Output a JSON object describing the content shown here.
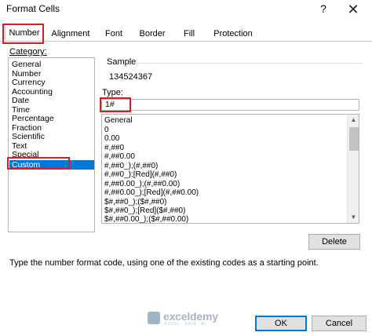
{
  "window": {
    "title": "Format Cells",
    "help_glyph": "?",
    "close_glyph": "✕"
  },
  "tabs": [
    {
      "label": "Number",
      "active": true
    },
    {
      "label": "Alignment"
    },
    {
      "label": "Font"
    },
    {
      "label": "Border"
    },
    {
      "label": "Fill"
    },
    {
      "label": "Protection"
    }
  ],
  "category": {
    "label": "Category:",
    "items": [
      "General",
      "Number",
      "Currency",
      "Accounting",
      "Date",
      "Time",
      "Percentage",
      "Fraction",
      "Scientific",
      "Text",
      "Special",
      "Custom"
    ],
    "selected": "Custom"
  },
  "sample": {
    "label": "Sample",
    "value": "134524367"
  },
  "type": {
    "label": "Type:",
    "value": "1#",
    "formats": [
      "General",
      "0",
      "0.00",
      "#,##0",
      "#,##0.00",
      "#,##0_);(#,##0)",
      "#,##0_);[Red](#,##0)",
      "#,##0.00_);(#,##0.00)",
      "#,##0.00_);[Red](#,##0.00)",
      "$#,##0_);($#,##0)",
      "$#,##0_);[Red]($#,##0)",
      "$#,##0.00_);($#,##0.00)"
    ]
  },
  "buttons": {
    "delete": "Delete",
    "ok": "OK",
    "cancel": "Cancel"
  },
  "help_text": "Type the number format code, using one of the existing codes as a starting point.",
  "watermark": {
    "name": "exceldemy",
    "tagline": "EXCEL · DATA · BI"
  },
  "colors": {
    "selection": "#0078d7",
    "highlight_box": "#e0191f"
  }
}
